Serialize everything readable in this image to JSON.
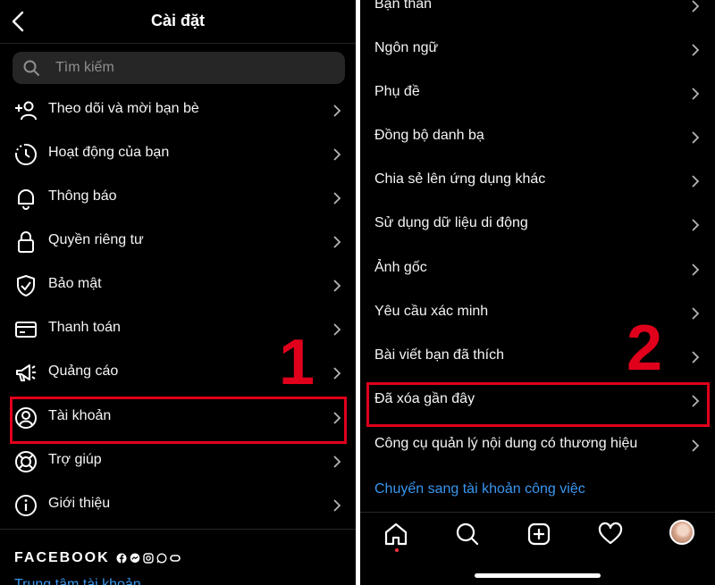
{
  "left_panel": {
    "title": "Cài đặt",
    "search": {
      "placeholder": "Tìm kiếm"
    },
    "items": [
      {
        "label": "Theo dõi và mời bạn bè",
        "icon": "add-person-icon"
      },
      {
        "label": "Hoạt động của bạn",
        "icon": "activity-clock-icon"
      },
      {
        "label": "Thông báo",
        "icon": "bell-icon"
      },
      {
        "label": "Quyền riêng tư",
        "icon": "lock-icon"
      },
      {
        "label": "Bảo mật",
        "icon": "shield-check-icon"
      },
      {
        "label": "Thanh toán",
        "icon": "credit-card-icon"
      },
      {
        "label": "Quảng cáo",
        "icon": "megaphone-icon"
      },
      {
        "label": "Tài khoản",
        "icon": "account-circle-icon"
      },
      {
        "label": "Trợ giúp",
        "icon": "lifebuoy-icon"
      },
      {
        "label": "Giới thiệu",
        "icon": "info-icon"
      }
    ],
    "annotation_number": "1",
    "facebook": {
      "title": "FACEBOOK",
      "link": "Trung tâm tài khoản"
    }
  },
  "right_panel": {
    "items": [
      {
        "label": "Bạn thân"
      },
      {
        "label": "Ngôn ngữ"
      },
      {
        "label": "Phụ đề"
      },
      {
        "label": "Đồng bộ danh bạ"
      },
      {
        "label": "Chia sẻ lên ứng dụng khác"
      },
      {
        "label": "Sử dụng dữ liệu di động"
      },
      {
        "label": "Ảnh gốc"
      },
      {
        "label": "Yêu cầu xác minh"
      },
      {
        "label": "Bài viết bạn đã thích"
      },
      {
        "label": "Đã xóa gần đây"
      },
      {
        "label": "Công cụ quản lý nội dung có thương hiệu"
      }
    ],
    "switch_link": "Chuyển sang tài khoản công việc",
    "annotation_number": "2",
    "tabs": [
      "home-icon",
      "search-icon",
      "create-icon",
      "heart-icon",
      "profile-avatar"
    ]
  },
  "colors": {
    "background": "#000000",
    "text": "#f5f5f5",
    "link": "#3897f0",
    "annotation": "#e0001b",
    "search_bg": "#262626"
  }
}
